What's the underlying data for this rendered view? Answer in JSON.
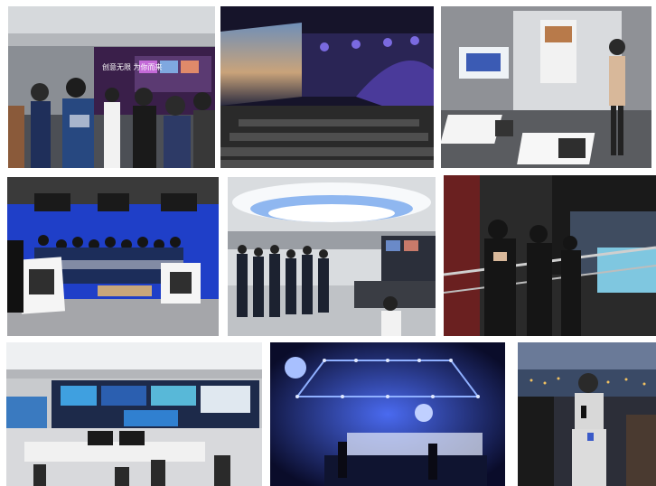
{
  "collage": {
    "tiles": [
      {
        "name": "exhibition-hall-visit-photo",
        "sign_text": "创意无限 为你而来"
      },
      {
        "name": "theater-auditorium-photo"
      },
      {
        "name": "presentation-room-qr-photo"
      },
      {
        "name": "blue-studio-group-photo"
      },
      {
        "name": "newsroom-tour-photo"
      },
      {
        "name": "balcony-viewing-photo"
      },
      {
        "name": "control-room-photo"
      },
      {
        "name": "stage-lighting-photo"
      },
      {
        "name": "city-view-interview-photo"
      }
    ]
  }
}
